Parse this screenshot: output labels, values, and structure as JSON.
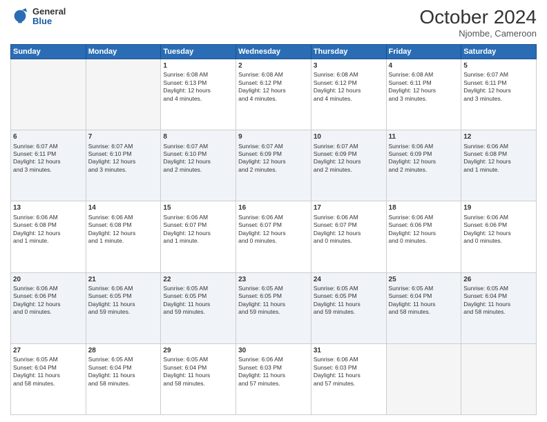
{
  "header": {
    "logo_general": "General",
    "logo_blue": "Blue",
    "month": "October 2024",
    "location": "Njombe, Cameroon"
  },
  "days_of_week": [
    "Sunday",
    "Monday",
    "Tuesday",
    "Wednesday",
    "Thursday",
    "Friday",
    "Saturday"
  ],
  "weeks": [
    {
      "shade": false,
      "days": [
        {
          "num": "",
          "info": ""
        },
        {
          "num": "",
          "info": ""
        },
        {
          "num": "1",
          "info": "Sunrise: 6:08 AM\nSunset: 6:13 PM\nDaylight: 12 hours\nand 4 minutes."
        },
        {
          "num": "2",
          "info": "Sunrise: 6:08 AM\nSunset: 6:12 PM\nDaylight: 12 hours\nand 4 minutes."
        },
        {
          "num": "3",
          "info": "Sunrise: 6:08 AM\nSunset: 6:12 PM\nDaylight: 12 hours\nand 4 minutes."
        },
        {
          "num": "4",
          "info": "Sunrise: 6:08 AM\nSunset: 6:11 PM\nDaylight: 12 hours\nand 3 minutes."
        },
        {
          "num": "5",
          "info": "Sunrise: 6:07 AM\nSunset: 6:11 PM\nDaylight: 12 hours\nand 3 minutes."
        }
      ]
    },
    {
      "shade": true,
      "days": [
        {
          "num": "6",
          "info": "Sunrise: 6:07 AM\nSunset: 6:11 PM\nDaylight: 12 hours\nand 3 minutes."
        },
        {
          "num": "7",
          "info": "Sunrise: 6:07 AM\nSunset: 6:10 PM\nDaylight: 12 hours\nand 3 minutes."
        },
        {
          "num": "8",
          "info": "Sunrise: 6:07 AM\nSunset: 6:10 PM\nDaylight: 12 hours\nand 2 minutes."
        },
        {
          "num": "9",
          "info": "Sunrise: 6:07 AM\nSunset: 6:09 PM\nDaylight: 12 hours\nand 2 minutes."
        },
        {
          "num": "10",
          "info": "Sunrise: 6:07 AM\nSunset: 6:09 PM\nDaylight: 12 hours\nand 2 minutes."
        },
        {
          "num": "11",
          "info": "Sunrise: 6:06 AM\nSunset: 6:09 PM\nDaylight: 12 hours\nand 2 minutes."
        },
        {
          "num": "12",
          "info": "Sunrise: 6:06 AM\nSunset: 6:08 PM\nDaylight: 12 hours\nand 1 minute."
        }
      ]
    },
    {
      "shade": false,
      "days": [
        {
          "num": "13",
          "info": "Sunrise: 6:06 AM\nSunset: 6:08 PM\nDaylight: 12 hours\nand 1 minute."
        },
        {
          "num": "14",
          "info": "Sunrise: 6:06 AM\nSunset: 6:08 PM\nDaylight: 12 hours\nand 1 minute."
        },
        {
          "num": "15",
          "info": "Sunrise: 6:06 AM\nSunset: 6:07 PM\nDaylight: 12 hours\nand 1 minute."
        },
        {
          "num": "16",
          "info": "Sunrise: 6:06 AM\nSunset: 6:07 PM\nDaylight: 12 hours\nand 0 minutes."
        },
        {
          "num": "17",
          "info": "Sunrise: 6:06 AM\nSunset: 6:07 PM\nDaylight: 12 hours\nand 0 minutes."
        },
        {
          "num": "18",
          "info": "Sunrise: 6:06 AM\nSunset: 6:06 PM\nDaylight: 12 hours\nand 0 minutes."
        },
        {
          "num": "19",
          "info": "Sunrise: 6:06 AM\nSunset: 6:06 PM\nDaylight: 12 hours\nand 0 minutes."
        }
      ]
    },
    {
      "shade": true,
      "days": [
        {
          "num": "20",
          "info": "Sunrise: 6:06 AM\nSunset: 6:06 PM\nDaylight: 12 hours\nand 0 minutes."
        },
        {
          "num": "21",
          "info": "Sunrise: 6:06 AM\nSunset: 6:05 PM\nDaylight: 11 hours\nand 59 minutes."
        },
        {
          "num": "22",
          "info": "Sunrise: 6:05 AM\nSunset: 6:05 PM\nDaylight: 11 hours\nand 59 minutes."
        },
        {
          "num": "23",
          "info": "Sunrise: 6:05 AM\nSunset: 6:05 PM\nDaylight: 11 hours\nand 59 minutes."
        },
        {
          "num": "24",
          "info": "Sunrise: 6:05 AM\nSunset: 6:05 PM\nDaylight: 11 hours\nand 59 minutes."
        },
        {
          "num": "25",
          "info": "Sunrise: 6:05 AM\nSunset: 6:04 PM\nDaylight: 11 hours\nand 58 minutes."
        },
        {
          "num": "26",
          "info": "Sunrise: 6:05 AM\nSunset: 6:04 PM\nDaylight: 11 hours\nand 58 minutes."
        }
      ]
    },
    {
      "shade": false,
      "days": [
        {
          "num": "27",
          "info": "Sunrise: 6:05 AM\nSunset: 6:04 PM\nDaylight: 11 hours\nand 58 minutes."
        },
        {
          "num": "28",
          "info": "Sunrise: 6:05 AM\nSunset: 6:04 PM\nDaylight: 11 hours\nand 58 minutes."
        },
        {
          "num": "29",
          "info": "Sunrise: 6:05 AM\nSunset: 6:04 PM\nDaylight: 11 hours\nand 58 minutes."
        },
        {
          "num": "30",
          "info": "Sunrise: 6:06 AM\nSunset: 6:03 PM\nDaylight: 11 hours\nand 57 minutes."
        },
        {
          "num": "31",
          "info": "Sunrise: 6:06 AM\nSunset: 6:03 PM\nDaylight: 11 hours\nand 57 minutes."
        },
        {
          "num": "",
          "info": ""
        },
        {
          "num": "",
          "info": ""
        }
      ]
    }
  ]
}
